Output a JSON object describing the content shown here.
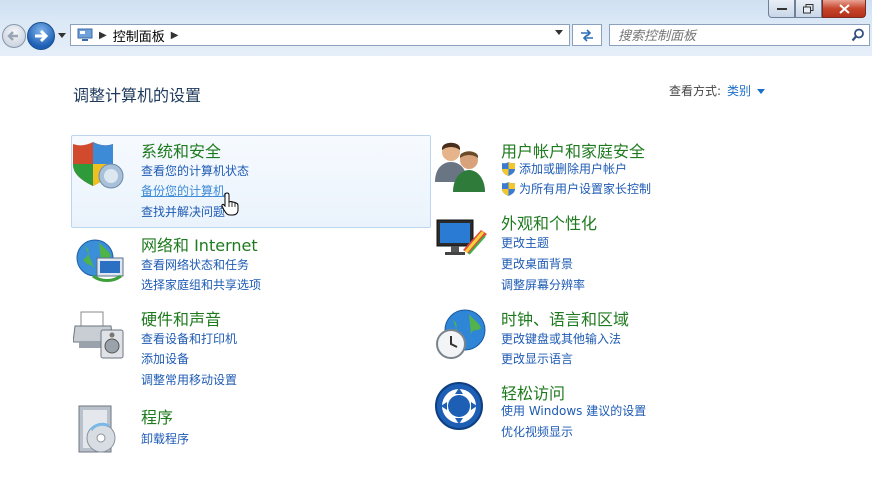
{
  "address_bar": {
    "crumb": "控制面板"
  },
  "search": {
    "placeholder": "搜索控制面板"
  },
  "header": {
    "title": "调整计算机的设置",
    "view_by_label": "查看方式:",
    "view_by_value": "类别"
  },
  "categories": [
    {
      "title": "系统和安全",
      "icon": "shield-icon",
      "links": [
        "查看您的计算机状态",
        "备份您的计算机",
        "查找并解决问题"
      ]
    },
    {
      "title": "网络和 Internet",
      "icon": "network-globe-icon",
      "links": [
        "查看网络状态和任务",
        "选择家庭组和共享选项"
      ]
    },
    {
      "title": "硬件和声音",
      "icon": "printer-icon",
      "links": [
        "查看设备和打印机",
        "添加设备",
        "调整常用移动设置"
      ]
    },
    {
      "title": "程序",
      "icon": "programs-icon",
      "links": [
        "卸载程序"
      ]
    },
    {
      "title": "用户帐户和家庭安全",
      "icon": "users-icon",
      "links": [
        "添加或删除用户帐户",
        "为所有用户设置家长控制"
      ]
    },
    {
      "title": "外观和个性化",
      "icon": "appearance-icon",
      "links": [
        "更改主题",
        "更改桌面背景",
        "调整屏幕分辨率"
      ]
    },
    {
      "title": "时钟、语言和区域",
      "icon": "clock-globe-icon",
      "links": [
        "更改键盘或其他输入法",
        "更改显示语言"
      ]
    },
    {
      "title": "轻松访问",
      "icon": "ease-of-access-icon",
      "links": [
        "使用 Windows 建议的设置",
        "优化视频显示"
      ]
    }
  ]
}
